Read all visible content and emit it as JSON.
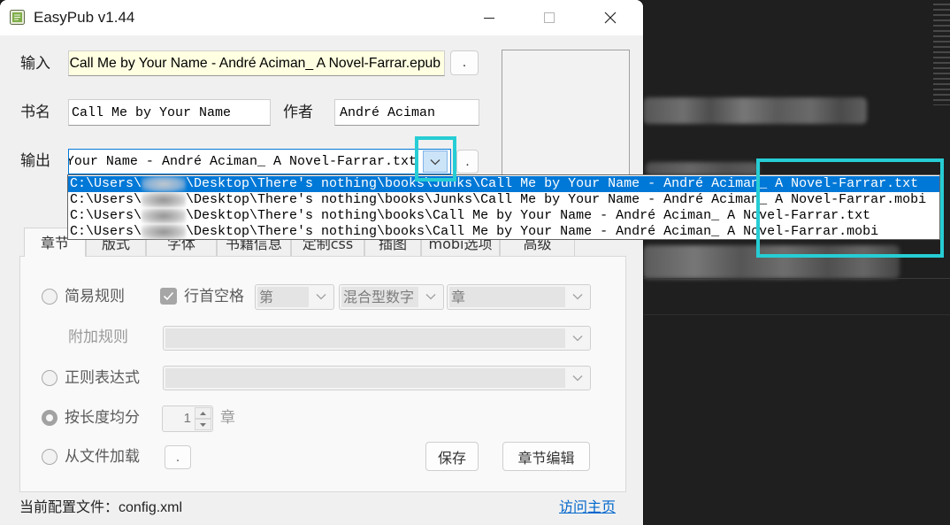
{
  "window": {
    "title": "EasyPub v1.44"
  },
  "main_form": {
    "input": {
      "label": "输入",
      "value": "Call Me by Your Name - André Aciman_ A Novel-Farrar.epub",
      "browse_label": "."
    },
    "book_name": {
      "label": "书名",
      "value": "Call Me by Your Name"
    },
    "author": {
      "label": "作者",
      "value": "André Aciman"
    },
    "output": {
      "label": "输出",
      "value": "Your Name - André Aciman_ A Novel-Farrar.txt",
      "browse_label": ".",
      "dropdown_open": true,
      "options": [
        {
          "prefix": "C:\\Users\\",
          "suffix": "\\Desktop\\There's nothing\\books\\Junks\\Call Me by Your Name - André Aciman_ A Novel-Farrar.txt",
          "highlighted": true
        },
        {
          "prefix": "C:\\Users\\",
          "suffix": "\\Desktop\\There's nothing\\books\\Junks\\Call Me by Your Name - André Aciman_ A Novel-Farrar.mobi",
          "highlighted": false
        },
        {
          "prefix": "C:\\Users\\",
          "suffix": "\\Desktop\\There's nothing\\books\\Call Me by Your Name - André Aciman_ A Novel-Farrar.txt",
          "highlighted": false
        },
        {
          "prefix": "C:\\Users\\",
          "suffix": "\\Desktop\\There's nothing\\books\\Call Me by Your Name - André Aciman_ A Novel-Farrar.mobi",
          "highlighted": false
        }
      ]
    }
  },
  "tabs": [
    {
      "label": "章节",
      "selected": true
    },
    {
      "label": "版式",
      "selected": false
    },
    {
      "label": "字体",
      "selected": false
    },
    {
      "label": "书籍信息",
      "selected": false
    },
    {
      "label": "定制css",
      "selected": false
    },
    {
      "label": "插图",
      "selected": false
    },
    {
      "label": "mobi选项",
      "selected": false
    },
    {
      "label": "高级",
      "selected": false
    }
  ],
  "chapter_panel": {
    "simple_rule": {
      "label": "简易规则",
      "selected": false
    },
    "leading_space": {
      "label": "行首空格",
      "checked": true,
      "disabled": true
    },
    "prefix_select": {
      "value": "第",
      "disabled": true
    },
    "number_select": {
      "value": "混合型数字",
      "disabled": true
    },
    "suffix_select": {
      "value": "章",
      "disabled": true
    },
    "extra_rule": {
      "label": "附加规则",
      "value": "",
      "disabled": true
    },
    "regex": {
      "label": "正则表达式",
      "value": "",
      "selected": false
    },
    "split_by_length": {
      "label": "按长度均分",
      "selected": true,
      "count": "1",
      "unit": "章"
    },
    "load_from_file": {
      "label": "从文件加载",
      "browse_label": ".",
      "selected": false
    },
    "save_label": "保存",
    "edit_chapters_label": "章节编辑"
  },
  "status_bar": {
    "config_label": "当前配置文件：",
    "config_file": "config.xml",
    "homepage_link": "访问主页"
  },
  "colors": {
    "accent": "#0078d7",
    "annotation_box": "#26cdd4",
    "link": "#0066cc",
    "input_highlight_bg": "#ffffe1"
  },
  "icons": {
    "app": "app-icon",
    "minimize": "minimize-icon",
    "maximize": "maximize-icon",
    "close": "close-icon",
    "dropdown": "chevron-down-icon",
    "checkbox": "check-icon"
  }
}
